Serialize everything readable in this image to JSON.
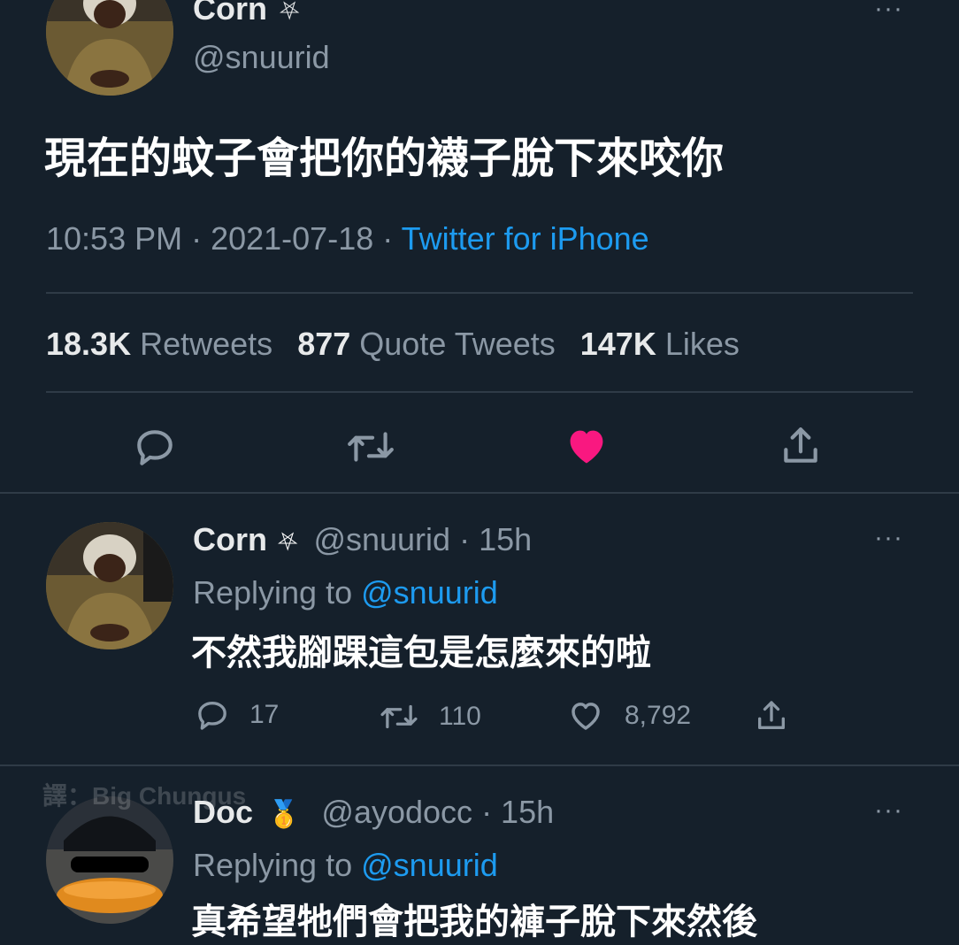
{
  "main_tweet": {
    "author_name": "Corn",
    "author_badge": "⛧",
    "handle": "@snuurid",
    "text": "現在的蚊子會把你的襪子脫下來咬你",
    "time": "10:53 PM · 2021-07-18 · ",
    "source": "Twitter for iPhone",
    "stats": {
      "retweets_count": "18.3K",
      "retweets_label": "Retweets",
      "quotes_count": "877",
      "quotes_label": "Quote Tweets",
      "likes_count": "147K",
      "likes_label": "Likes"
    },
    "liked": true,
    "more": "···"
  },
  "replies": [
    {
      "author_name": "Corn",
      "author_badge": "⛧",
      "handle": "@snuurid",
      "time": "· 15h",
      "replying_prefix": "Replying to",
      "replying_handle": "@snuurid",
      "text": "不然我腳踝這包是怎麼來的啦",
      "reply_count": "17",
      "retweet_count": "110",
      "like_count": "8,792",
      "more": "···"
    },
    {
      "author_name": "Doc",
      "author_badge": "🥇",
      "handle": "@ayodocc",
      "time": "· 15h",
      "replying_prefix": "Replying to",
      "replying_handle": "@snuurid",
      "text": "真希望牠們會把我的褲子脫下來然後",
      "more": "···"
    }
  ],
  "watermark": "譯：Big Chungus",
  "colors": {
    "background": "#15202b",
    "link": "#1d9bf0",
    "like": "#f91880",
    "muted": "#8b98a5"
  }
}
